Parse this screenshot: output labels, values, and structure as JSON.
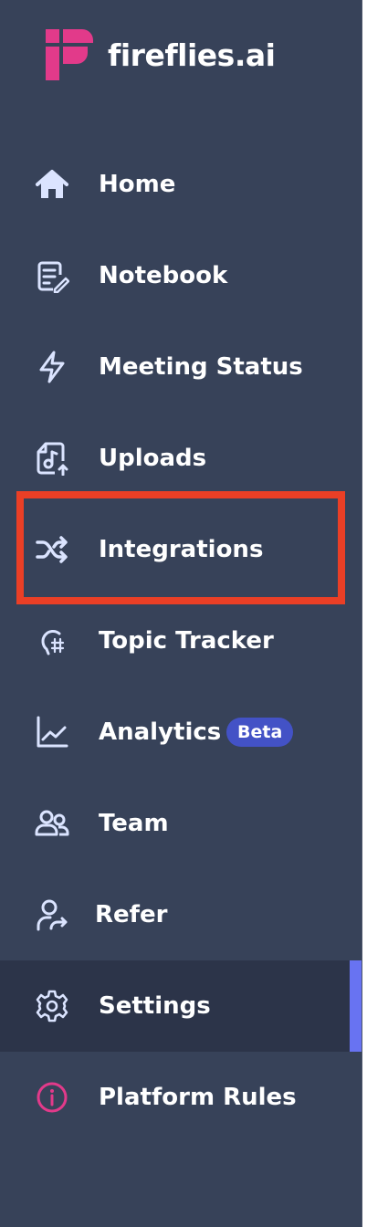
{
  "brand": {
    "name": "fireflies.ai",
    "logo_color": "#e23a8a"
  },
  "nav": {
    "items": [
      {
        "label": "Home",
        "icon": "home-icon"
      },
      {
        "label": "Notebook",
        "icon": "notebook-icon"
      },
      {
        "label": "Meeting Status",
        "icon": "lightning-icon"
      },
      {
        "label": "Uploads",
        "icon": "upload-music-file-icon"
      },
      {
        "label": "Integrations",
        "icon": "shuffle-icon",
        "highlighted": true
      },
      {
        "label": "Topic Tracker",
        "icon": "topic-tracker-icon"
      },
      {
        "label": "Analytics",
        "icon": "analytics-chart-icon",
        "badge": "Beta"
      },
      {
        "label": "Team",
        "icon": "team-icon"
      },
      {
        "label": "Refer",
        "icon": "refer-icon"
      },
      {
        "label": "Settings",
        "icon": "gear-icon",
        "active": true
      },
      {
        "label": "Platform Rules",
        "icon": "info-icon"
      }
    ]
  },
  "colors": {
    "sidebar_bg": "#374259",
    "active_bg": "#2c3449",
    "active_indicator": "#6873f2",
    "badge_bg": "#4352c6",
    "highlight_border": "#ea3f26",
    "platform_rules_icon": "#e23a8a"
  }
}
